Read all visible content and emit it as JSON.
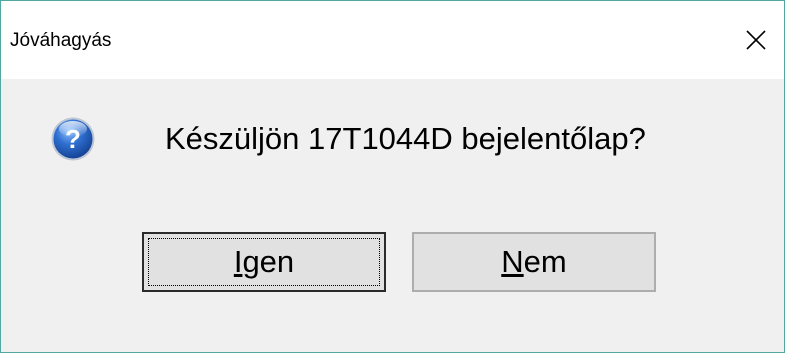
{
  "window": {
    "title": "Jóváhagyás",
    "close_symbol": "×"
  },
  "dialog": {
    "icon": "question-icon",
    "message": "Készüljön 17T1044D bejelentőlap?"
  },
  "buttons": {
    "yes": {
      "accel": "I",
      "rest": "gen",
      "label": "Igen"
    },
    "no": {
      "accel": "N",
      "rest": "em",
      "label": "Nem"
    }
  },
  "colors": {
    "window_border": "#4fa9a0",
    "titlebar_bg": "#ffffff",
    "content_bg": "#f0f0f0",
    "button_bg": "#e1e1e1",
    "icon_blue": "#1f5fb8"
  }
}
